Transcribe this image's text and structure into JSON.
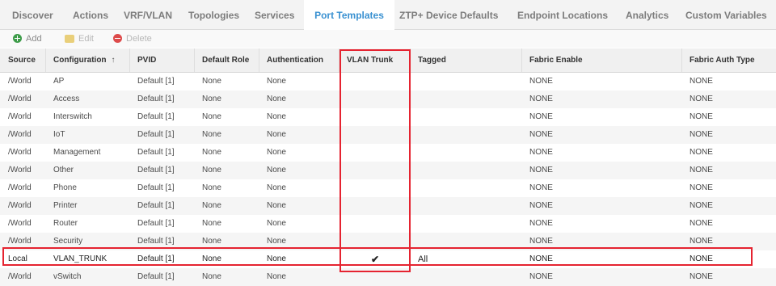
{
  "tabs": [
    {
      "label": "Discover",
      "active": false
    },
    {
      "label": "Actions",
      "active": false
    },
    {
      "label": "VRF/VLAN",
      "active": false
    },
    {
      "label": "Topologies",
      "active": false
    },
    {
      "label": "Services",
      "active": false
    },
    {
      "label": "Port Templates",
      "active": true
    },
    {
      "label": "ZTP+ Device Defaults",
      "active": false
    },
    {
      "label": "Endpoint Locations",
      "active": false
    },
    {
      "label": "Analytics",
      "active": false
    },
    {
      "label": "Custom Variables",
      "active": false
    }
  ],
  "toolbar": {
    "add_label": "Add",
    "edit_label": "Edit",
    "delete_label": "Delete"
  },
  "columns": [
    "Source",
    "Configuration",
    "PVID",
    "Default Role",
    "Authentication",
    "VLAN Trunk",
    "Tagged",
    "Fabric Enable",
    "Fabric Auth Type"
  ],
  "sort_indicator": "↑",
  "rows": [
    {
      "source": "/World",
      "configuration": "AP",
      "pvid": "Default [1]",
      "default_role": "None",
      "authentication": "None",
      "vlan_trunk": "",
      "tagged": "",
      "fabric_enable": "NONE",
      "fabric_auth_type": "NONE"
    },
    {
      "source": "/World",
      "configuration": "Access",
      "pvid": "Default [1]",
      "default_role": "None",
      "authentication": "None",
      "vlan_trunk": "",
      "tagged": "",
      "fabric_enable": "NONE",
      "fabric_auth_type": "NONE"
    },
    {
      "source": "/World",
      "configuration": "Interswitch",
      "pvid": "Default [1]",
      "default_role": "None",
      "authentication": "None",
      "vlan_trunk": "",
      "tagged": "",
      "fabric_enable": "NONE",
      "fabric_auth_type": "NONE"
    },
    {
      "source": "/World",
      "configuration": "IoT",
      "pvid": "Default [1]",
      "default_role": "None",
      "authentication": "None",
      "vlan_trunk": "",
      "tagged": "",
      "fabric_enable": "NONE",
      "fabric_auth_type": "NONE"
    },
    {
      "source": "/World",
      "configuration": "Management",
      "pvid": "Default [1]",
      "default_role": "None",
      "authentication": "None",
      "vlan_trunk": "",
      "tagged": "",
      "fabric_enable": "NONE",
      "fabric_auth_type": "NONE"
    },
    {
      "source": "/World",
      "configuration": "Other",
      "pvid": "Default [1]",
      "default_role": "None",
      "authentication": "None",
      "vlan_trunk": "",
      "tagged": "",
      "fabric_enable": "NONE",
      "fabric_auth_type": "NONE"
    },
    {
      "source": "/World",
      "configuration": "Phone",
      "pvid": "Default [1]",
      "default_role": "None",
      "authentication": "None",
      "vlan_trunk": "",
      "tagged": "",
      "fabric_enable": "NONE",
      "fabric_auth_type": "NONE"
    },
    {
      "source": "/World",
      "configuration": "Printer",
      "pvid": "Default [1]",
      "default_role": "None",
      "authentication": "None",
      "vlan_trunk": "",
      "tagged": "",
      "fabric_enable": "NONE",
      "fabric_auth_type": "NONE"
    },
    {
      "source": "/World",
      "configuration": "Router",
      "pvid": "Default [1]",
      "default_role": "None",
      "authentication": "None",
      "vlan_trunk": "",
      "tagged": "",
      "fabric_enable": "NONE",
      "fabric_auth_type": "NONE"
    },
    {
      "source": "/World",
      "configuration": "Security",
      "pvid": "Default [1]",
      "default_role": "None",
      "authentication": "None",
      "vlan_trunk": "",
      "tagged": "",
      "fabric_enable": "NONE",
      "fabric_auth_type": "NONE"
    },
    {
      "source": "Local",
      "configuration": "VLAN_TRUNK",
      "pvid": "Default [1]",
      "default_role": "None",
      "authentication": "None",
      "vlan_trunk": "✔",
      "tagged": "All",
      "fabric_enable": "NONE",
      "fabric_auth_type": "NONE",
      "highlighted": true
    },
    {
      "source": "/World",
      "configuration": "vSwitch",
      "pvid": "Default [1]",
      "default_role": "None",
      "authentication": "None",
      "vlan_trunk": "",
      "tagged": "",
      "fabric_enable": "NONE",
      "fabric_auth_type": "NONE"
    }
  ],
  "colors": {
    "active_tab": "#3a91d1",
    "highlight": "#e52330",
    "add": "#3e9c4a",
    "delete": "#dd4b4b"
  },
  "icons": [
    "add-icon",
    "edit-icon",
    "delete-icon"
  ]
}
